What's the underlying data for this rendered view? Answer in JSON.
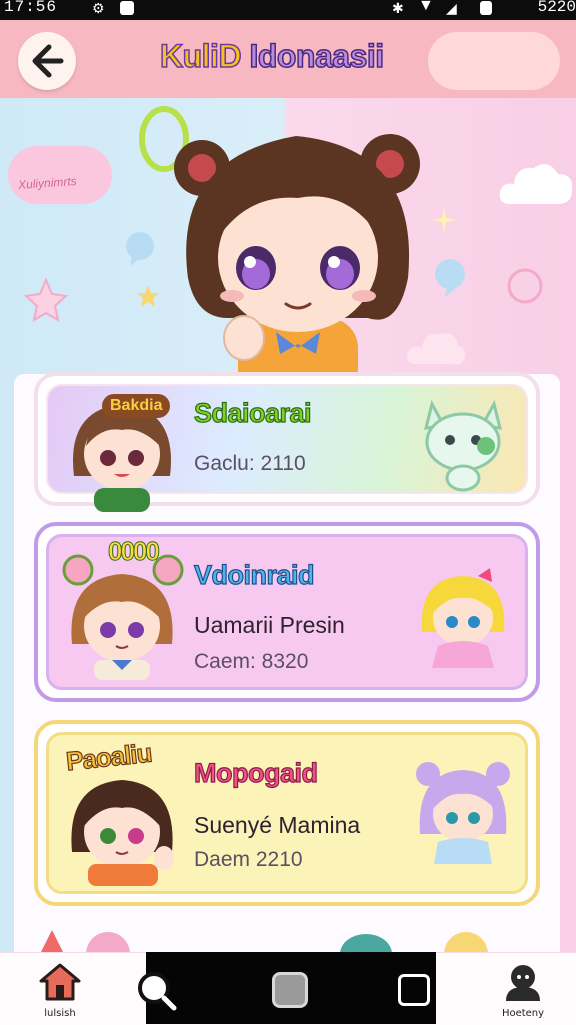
{
  "status_bar": {
    "time": "17:56",
    "battery": "5220"
  },
  "header": {
    "title_part1": "KuliD",
    "title_part2": "Idonaasii"
  },
  "hero": {
    "bubble_text": "Xuliynimrts"
  },
  "cards": [
    {
      "badge": "Bakdia",
      "title": "Sdaioarai",
      "subtitle": "",
      "detail": "Gaclu: 2110",
      "title_color": "#6cd21f",
      "outline": "#2c6a1b",
      "tint": "pastel-rainbow"
    },
    {
      "badge": "0000",
      "title": "Vdoinraid",
      "subtitle": "Uamarii Presin",
      "detail": "Caem: 8320",
      "title_color": "#3aa8e8",
      "outline": "#1d4f8a",
      "tint": "#f6c8f2"
    },
    {
      "badge": "Paoaliu",
      "title": "Mopogaid",
      "subtitle": "Suenyé Mamina",
      "detail": "Daem 2210",
      "title_color": "#f0457f",
      "outline": "#8a1e45",
      "tint": "#fdf0b0"
    }
  ],
  "bottom_nav": {
    "home_label": "lulsish",
    "profile_label": "Hoeteny"
  },
  "colors": {
    "header": "#f8b8c2",
    "panel": "#fdfbff",
    "purple_border": "#c29be6",
    "yellow_border": "#f5d77a"
  }
}
